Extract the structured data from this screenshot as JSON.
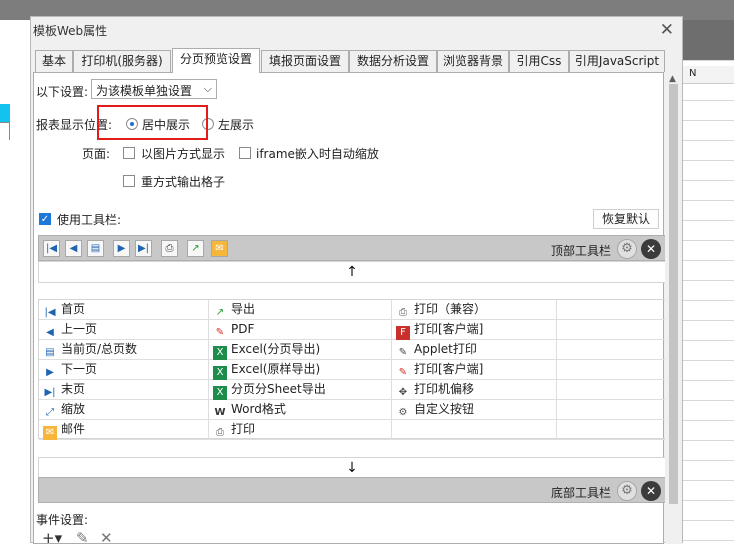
{
  "dialog": {
    "title": "模板Web属性",
    "close_icon": "✕"
  },
  "tabs": [
    {
      "label": "基本",
      "active": false
    },
    {
      "label": "打印机(服务器)",
      "active": false
    },
    {
      "label": "分页预览设置",
      "active": true
    },
    {
      "label": "填报页面设置",
      "active": false
    },
    {
      "label": "数据分析设置",
      "active": false
    },
    {
      "label": "浏览器背景",
      "active": false
    },
    {
      "label": "引用Css",
      "active": false
    },
    {
      "label": "引用JavaScript",
      "active": false
    }
  ],
  "settings": {
    "scope_label": "以下设置:",
    "scope_value": "为该模板单独设置",
    "position_label": "报表显示位置:",
    "position_options": [
      {
        "label": "居中展示",
        "selected": true
      },
      {
        "label": "左展示",
        "selected": false
      }
    ],
    "page_label": "页面:",
    "page_checks": [
      {
        "label": "以图片方式显示",
        "checked": false
      },
      {
        "label": "iframe嵌入时自动缩放",
        "checked": false
      },
      {
        "label": "重方式输出格子",
        "checked": false
      }
    ],
    "use_toolbar_label": "使用工具栏:",
    "use_toolbar_checked": true,
    "restore_default_label": "恢复默认"
  },
  "toolbar": {
    "top_label": "顶部工具栏",
    "bottom_label": "底部工具栏",
    "up_arrow": "↑",
    "down_arrow": "↓",
    "items": [
      {
        "label": "首页",
        "icon": "first-page-icon"
      },
      {
        "label": "导出",
        "icon": "export-icon"
      },
      {
        "label": "打印（兼容）",
        "icon": "print-icon"
      },
      {
        "label": "上一页",
        "icon": "prev-page-icon"
      },
      {
        "label": "PDF",
        "icon": "pdf-icon"
      },
      {
        "label": "打印[客户端]",
        "icon": "flash-print-icon"
      },
      {
        "label": "当前页/总页数",
        "icon": "page-count-icon"
      },
      {
        "label": "Excel(分页导出)",
        "icon": "excel-icon"
      },
      {
        "label": "Applet打印",
        "icon": "applet-print-icon"
      },
      {
        "label": "下一页",
        "icon": "next-page-icon"
      },
      {
        "label": "Excel(原样导出)",
        "icon": "excel-icon"
      },
      {
        "label": "打印[客户端]",
        "icon": "pdf-print-icon"
      },
      {
        "label": "末页",
        "icon": "last-page-icon"
      },
      {
        "label": "分页分Sheet导出",
        "icon": "excel-sheet-icon"
      },
      {
        "label": "打印机偏移",
        "icon": "move-icon"
      },
      {
        "label": "缩放",
        "icon": "zoom-icon"
      },
      {
        "label": "Word格式",
        "icon": "word-icon"
      },
      {
        "label": "自定义按钮",
        "icon": "gear-icon"
      },
      {
        "label": "邮件",
        "icon": "mail-icon"
      },
      {
        "label": "打印",
        "icon": "print-icon"
      },
      {
        "label": "",
        "icon": ""
      }
    ]
  },
  "events": {
    "label": "事件设置:"
  },
  "background": {
    "column_header": "N"
  }
}
